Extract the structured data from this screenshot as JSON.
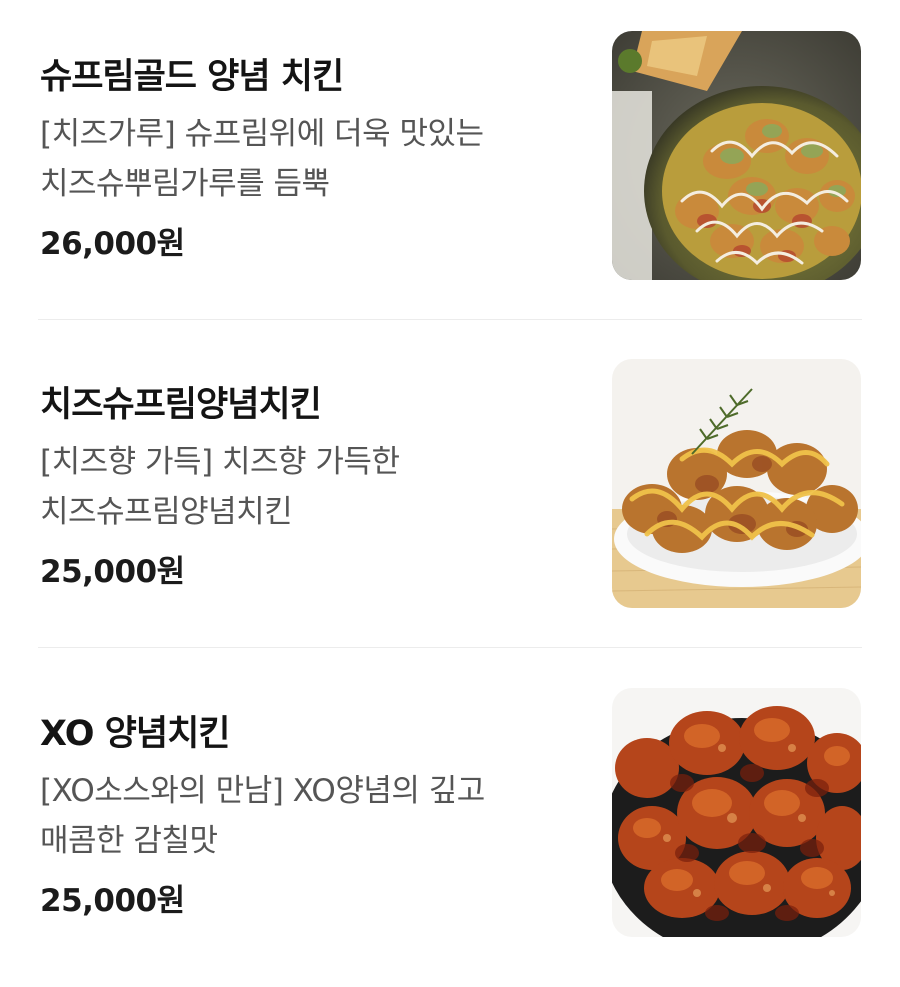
{
  "menu": {
    "items": [
      {
        "name": "슈프림골드 양념 치킨",
        "description": "[치즈가루] 슈프림위에 더욱 맛있는 치즈슈뿌림가루를 듬뿍",
        "price": "26,000원",
        "photo": "supreme-gold-chicken-photo"
      },
      {
        "name": "치즈슈프림양념치킨",
        "description": "[치즈향 가득] 치즈향 가득한 치즈슈프림양념치킨",
        "price": "25,000원",
        "photo": "cheese-supreme-chicken-photo"
      },
      {
        "name": "XO 양념치킨",
        "description": "[XO소스와의 만남] XO양념의 깊고 매콤한 감칠맛",
        "price": "25,000원",
        "photo": "xo-chicken-photo"
      }
    ]
  }
}
